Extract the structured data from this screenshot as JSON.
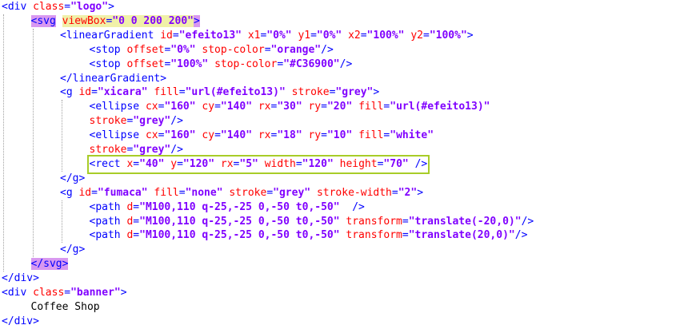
{
  "editor": {
    "lines": [
      {
        "indent": 0,
        "parts": [
          [
            "tag",
            "<div "
          ],
          [
            "attr",
            "class"
          ],
          [
            "tag",
            "="
          ],
          [
            "val",
            "\"logo\""
          ],
          [
            "tag",
            ">"
          ]
        ]
      },
      {
        "indent": 1,
        "parts": [
          [
            "tag-match",
            "<svg"
          ],
          [
            "tag",
            " "
          ],
          [
            "sel-attr",
            "viewBox=\"0 0 200 200\""
          ],
          [
            "tag-match",
            ">"
          ]
        ],
        "style": "svg-open"
      },
      {
        "indent": 2,
        "parts": [
          [
            "tag",
            "<linearGradient "
          ],
          [
            "attr",
            "id"
          ],
          [
            "tag",
            "="
          ],
          [
            "val",
            "\"efeito13\" "
          ],
          [
            "attr",
            "x1"
          ],
          [
            "tag",
            "="
          ],
          [
            "val",
            "\"0%\" "
          ],
          [
            "attr",
            "y1"
          ],
          [
            "tag",
            "="
          ],
          [
            "val",
            "\"0%\" "
          ],
          [
            "attr",
            "x2"
          ],
          [
            "tag",
            "="
          ],
          [
            "val",
            "\"100%\" "
          ],
          [
            "attr",
            "y2"
          ],
          [
            "tag",
            "="
          ],
          [
            "val",
            "\"100%\""
          ],
          [
            "tag",
            ">"
          ]
        ]
      },
      {
        "indent": 3,
        "parts": [
          [
            "tag",
            "<stop "
          ],
          [
            "attr",
            "offset"
          ],
          [
            "tag",
            "="
          ],
          [
            "val",
            "\"0%\" "
          ],
          [
            "attr",
            "stop-color"
          ],
          [
            "tag",
            "="
          ],
          [
            "val",
            "\"orange\""
          ],
          [
            "tag",
            "/>"
          ]
        ]
      },
      {
        "indent": 3,
        "parts": [
          [
            "tag",
            "<stop "
          ],
          [
            "attr",
            "offset"
          ],
          [
            "tag",
            "="
          ],
          [
            "val",
            "\"100%\" "
          ],
          [
            "attr",
            "stop-color"
          ],
          [
            "tag",
            "="
          ],
          [
            "val",
            "\"#C36900\""
          ],
          [
            "tag",
            "/>"
          ]
        ]
      },
      {
        "indent": 2,
        "parts": [
          [
            "tag",
            "</linearGradient>"
          ]
        ]
      },
      {
        "indent": 2,
        "parts": [
          [
            "tag",
            "<g "
          ],
          [
            "attr",
            "id"
          ],
          [
            "tag",
            "="
          ],
          [
            "val",
            "\"xicara\" "
          ],
          [
            "attr",
            "fill"
          ],
          [
            "tag",
            "="
          ],
          [
            "val",
            "\"url(#efeito13)\" "
          ],
          [
            "attr",
            "stroke"
          ],
          [
            "tag",
            "="
          ],
          [
            "val",
            "\"grey\""
          ],
          [
            "tag",
            ">"
          ]
        ]
      },
      {
        "indent": 3,
        "parts": [
          [
            "tag",
            "<ellipse "
          ],
          [
            "attr",
            "cx"
          ],
          [
            "tag",
            "="
          ],
          [
            "val",
            "\"160\" "
          ],
          [
            "attr",
            "cy"
          ],
          [
            "tag",
            "="
          ],
          [
            "val",
            "\"140\" "
          ],
          [
            "attr",
            "rx"
          ],
          [
            "tag",
            "="
          ],
          [
            "val",
            "\"30\" "
          ],
          [
            "attr",
            "ry"
          ],
          [
            "tag",
            "="
          ],
          [
            "val",
            "\"20\" "
          ],
          [
            "attr",
            "fill"
          ],
          [
            "tag",
            "="
          ],
          [
            "val",
            "\"url(#efeito13)\""
          ]
        ]
      },
      {
        "indent": 3,
        "parts": [
          [
            "attr",
            "stroke"
          ],
          [
            "tag",
            "="
          ],
          [
            "val",
            "\"grey\""
          ],
          [
            "tag",
            "/>"
          ]
        ]
      },
      {
        "indent": 3,
        "parts": [
          [
            "tag",
            "<ellipse "
          ],
          [
            "attr",
            "cx"
          ],
          [
            "tag",
            "="
          ],
          [
            "val",
            "\"160\" "
          ],
          [
            "attr",
            "cy"
          ],
          [
            "tag",
            "="
          ],
          [
            "val",
            "\"140\" "
          ],
          [
            "attr",
            "rx"
          ],
          [
            "tag",
            "="
          ],
          [
            "val",
            "\"18\" "
          ],
          [
            "attr",
            "ry"
          ],
          [
            "tag",
            "="
          ],
          [
            "val",
            "\"10\" "
          ],
          [
            "attr",
            "fill"
          ],
          [
            "tag",
            "="
          ],
          [
            "val",
            "\"white\""
          ]
        ]
      },
      {
        "indent": 3,
        "parts": [
          [
            "attr",
            "stroke"
          ],
          [
            "tag",
            "="
          ],
          [
            "val",
            "\"grey\""
          ],
          [
            "tag",
            "/>"
          ]
        ]
      },
      {
        "indent": 3,
        "parts": [
          [
            "tag",
            "<rect "
          ],
          [
            "attr",
            "x"
          ],
          [
            "tag",
            "="
          ],
          [
            "val",
            "\"40\" "
          ],
          [
            "attr",
            "y"
          ],
          [
            "tag",
            "="
          ],
          [
            "val",
            "\"120\" "
          ],
          [
            "attr",
            "rx"
          ],
          [
            "tag",
            "="
          ],
          [
            "val",
            "\"5\" "
          ],
          [
            "attr",
            "width"
          ],
          [
            "tag",
            "="
          ],
          [
            "val",
            "\"120\" "
          ],
          [
            "attr",
            "height"
          ],
          [
            "tag",
            "="
          ],
          [
            "val",
            "\"70\" "
          ],
          [
            "tag",
            "/>"
          ]
        ],
        "style": "boxed"
      },
      {
        "indent": 2,
        "parts": [
          [
            "tag",
            "</g>"
          ]
        ]
      },
      {
        "indent": 2,
        "parts": [
          [
            "tag",
            "<g "
          ],
          [
            "attr",
            "id"
          ],
          [
            "tag",
            "="
          ],
          [
            "val",
            "\"fumaca\" "
          ],
          [
            "attr",
            "fill"
          ],
          [
            "tag",
            "="
          ],
          [
            "val",
            "\"none\" "
          ],
          [
            "attr",
            "stroke"
          ],
          [
            "tag",
            "="
          ],
          [
            "val",
            "\"grey\" "
          ],
          [
            "attr",
            "stroke-width"
          ],
          [
            "tag",
            "="
          ],
          [
            "val",
            "\"2\""
          ],
          [
            "tag",
            ">"
          ]
        ]
      },
      {
        "indent": 3,
        "parts": [
          [
            "tag",
            "<path "
          ],
          [
            "attr",
            "d"
          ],
          [
            "tag",
            "="
          ],
          [
            "val",
            "\"M100,110 q-25,-25 0,-50 t0,-50\"  "
          ],
          [
            "tag",
            "/>"
          ]
        ]
      },
      {
        "indent": 3,
        "parts": [
          [
            "tag",
            "<path "
          ],
          [
            "attr",
            "d"
          ],
          [
            "tag",
            "="
          ],
          [
            "val",
            "\"M100,110 q-25,-25 0,-50 t0,-50\" "
          ],
          [
            "attr",
            "transform"
          ],
          [
            "tag",
            "="
          ],
          [
            "val",
            "\"translate(-20,0)\""
          ],
          [
            "tag",
            "/>"
          ]
        ]
      },
      {
        "indent": 3,
        "parts": [
          [
            "tag",
            "<path "
          ],
          [
            "attr",
            "d"
          ],
          [
            "tag",
            "="
          ],
          [
            "val",
            "\"M100,110 q-25,-25 0,-50 t0,-50\" "
          ],
          [
            "attr",
            "transform"
          ],
          [
            "tag",
            "="
          ],
          [
            "val",
            "\"translate(20,0)\""
          ],
          [
            "tag",
            "/>"
          ]
        ]
      },
      {
        "indent": 2,
        "parts": [
          [
            "tag",
            "</g>"
          ]
        ]
      },
      {
        "indent": 1,
        "parts": [
          [
            "tag-match",
            "</svg"
          ],
          [
            "tag-match",
            ">"
          ]
        ]
      },
      {
        "indent": 0,
        "parts": [
          [
            "tag",
            "</div>"
          ]
        ]
      },
      {
        "indent": 0,
        "parts": [
          [
            "tag",
            "<div "
          ],
          [
            "attr",
            "class"
          ],
          [
            "tag",
            "="
          ],
          [
            "val",
            "\"banner\""
          ],
          [
            "tag",
            ">"
          ]
        ]
      },
      {
        "indent": 1,
        "parts": [
          [
            "txt",
            "Coffee Shop"
          ]
        ]
      },
      {
        "indent": 0,
        "parts": [
          [
            "tag",
            "</div>"
          ]
        ]
      }
    ]
  },
  "colors": {
    "tag": "#0000ff",
    "attribute": "#ff0000",
    "value": "#8000ff",
    "text": "#000000",
    "tag_match_highlight": "#d898f0",
    "selection_highlight": "#f0f0a8",
    "box_outline": "#a8cc28"
  }
}
